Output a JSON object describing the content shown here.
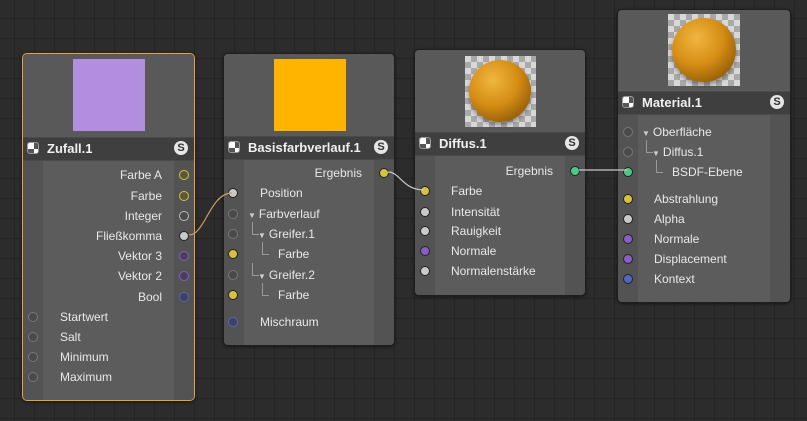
{
  "nodes": {
    "zufall": {
      "title": "Zufall.1",
      "swatch_color": "#b38ee0",
      "outputs": [
        "Farbe A",
        "Farbe",
        "Integer",
        "Fließkomma",
        "Vektor 3",
        "Vektor 2",
        "Bool"
      ],
      "inputs": [
        "Startwert",
        "Salt",
        "Minimum",
        "Maximum"
      ]
    },
    "basis": {
      "title": "Basisfarbverlauf.1",
      "swatch_color": "#ffb400",
      "output": "Ergebnis",
      "position": "Position",
      "farbverlauf": "Farbverlauf",
      "greifer1": "Greifer.1",
      "greifer1_farbe": "Farbe",
      "greifer2": "Greifer.2",
      "greifer2_farbe": "Farbe",
      "mischraum": "Mischraum"
    },
    "diffus": {
      "title": "Diffus.1",
      "output": "Ergebnis",
      "inputs": [
        "Farbe",
        "Intensität",
        "Rauigkeit",
        "Normale",
        "Normalenstärke"
      ]
    },
    "material": {
      "title": "Material.1",
      "oberflaeche": "Oberfläche",
      "diffus": "Diffus.1",
      "bsdf": "BSDF-Ebene",
      "inputs": [
        "Abstrahlung",
        "Alpha",
        "Normale",
        "Displacement",
        "Kontext"
      ]
    }
  },
  "colors": {
    "selected_border": "#e9a13b",
    "port_yellow": "#d9c03e",
    "port_purple": "#8a5cc7",
    "port_blue": "#5167c2",
    "port_green": "#4fc783"
  }
}
